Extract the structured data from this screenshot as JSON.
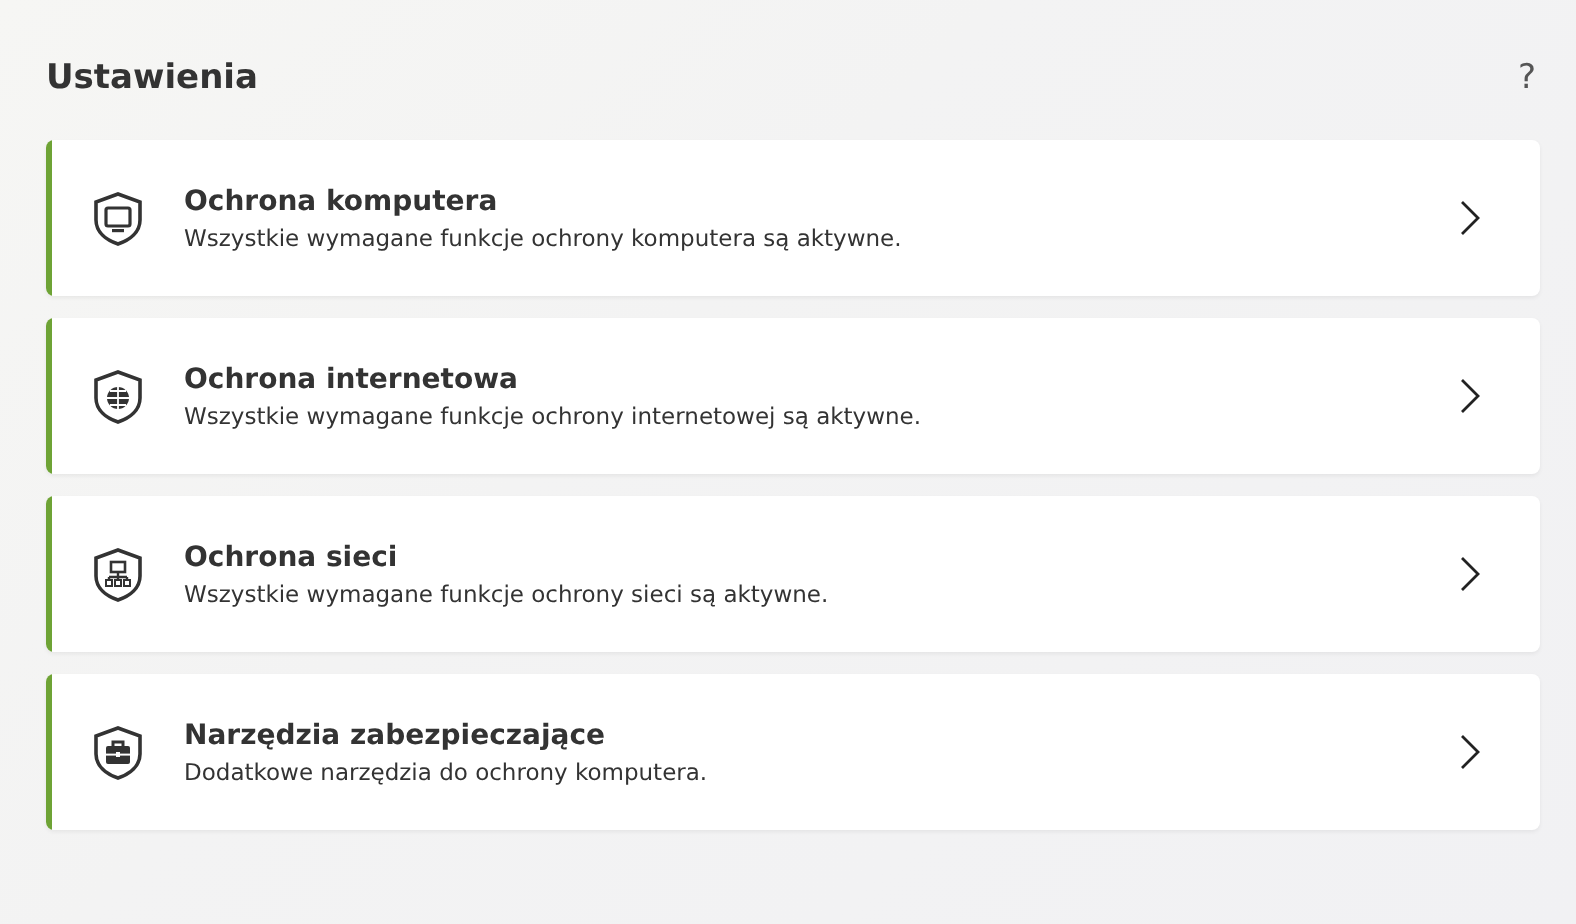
{
  "header": {
    "title": "Ustawienia",
    "help": "?"
  },
  "sections": [
    {
      "kind": "monitor",
      "active": true,
      "title": "Ochrona komputera",
      "description": "Wszystkie wymagane funkcje ochrony komputera są aktywne."
    },
    {
      "kind": "globe",
      "active": true,
      "title": "Ochrona internetowa",
      "description": "Wszystkie wymagane funkcje ochrony internetowej są aktywne."
    },
    {
      "kind": "network",
      "active": true,
      "title": "Ochrona sieci",
      "description": "Wszystkie wymagane funkcje ochrony sieci są aktywne."
    },
    {
      "kind": "toolbox",
      "active": true,
      "title": "Narzędzia zabezpieczające",
      "description": "Dodatkowe narzędzia do ochrony komputera."
    }
  ]
}
